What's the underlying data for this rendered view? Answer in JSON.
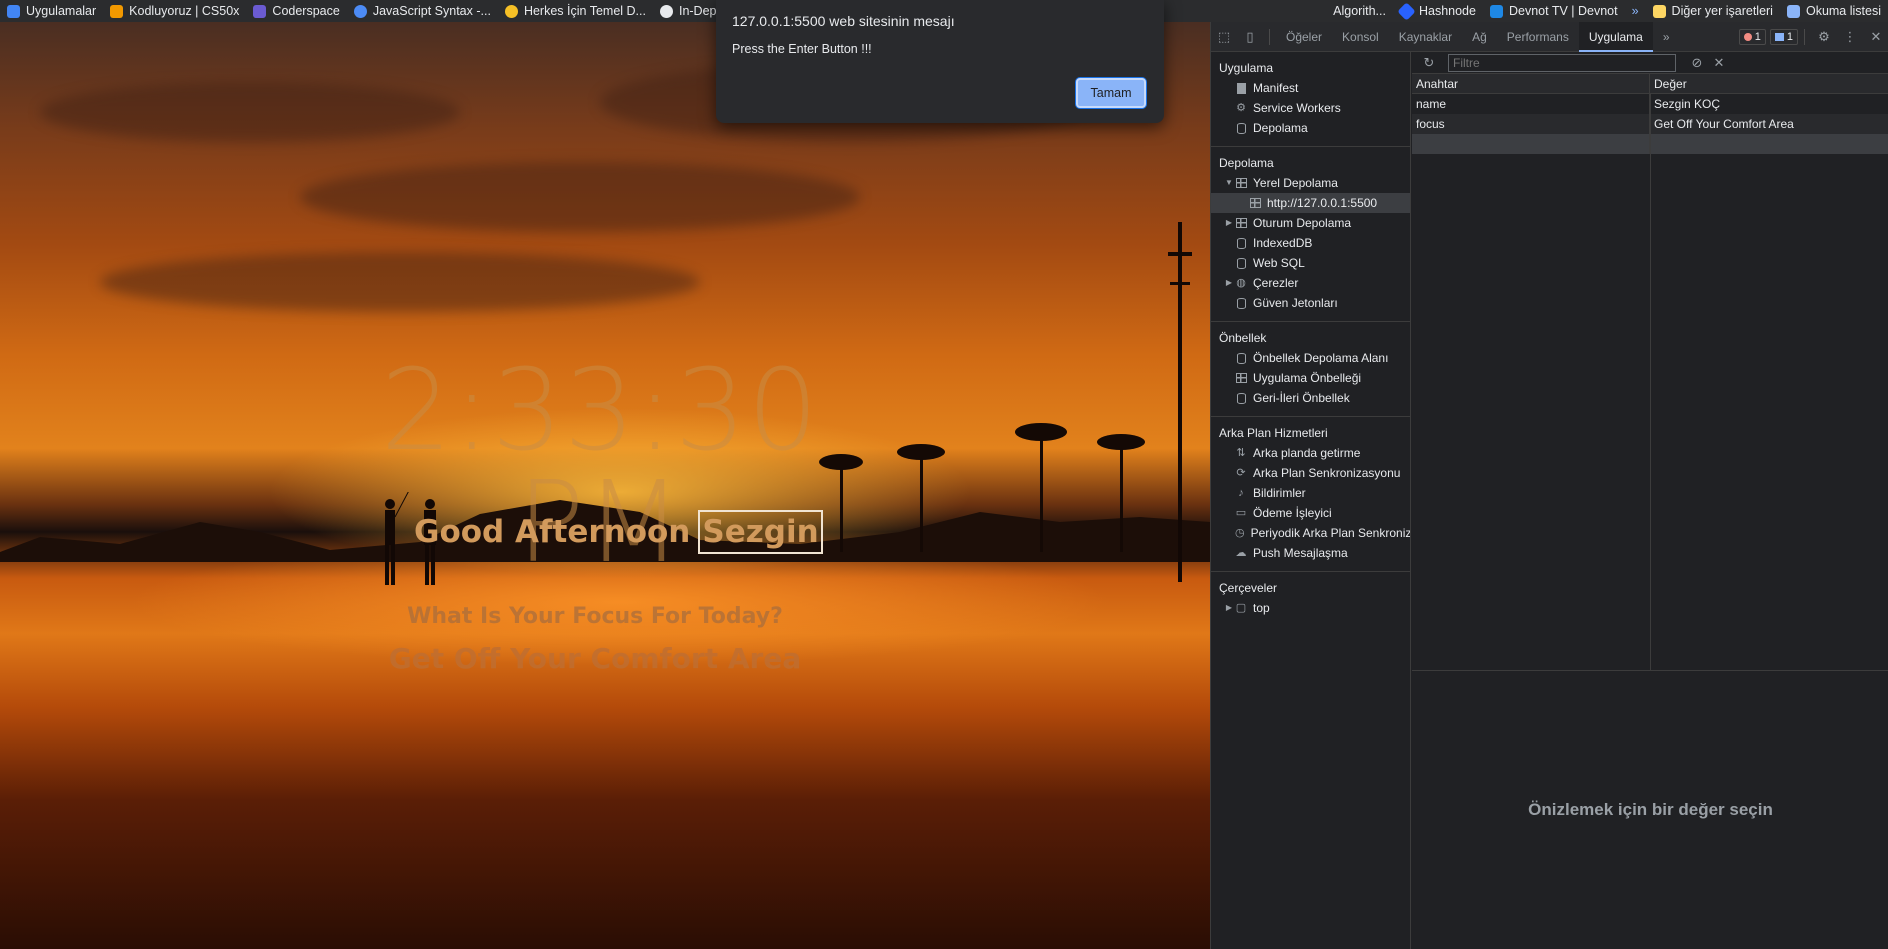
{
  "bookmarks": {
    "items": [
      {
        "label": "Uygulamalar",
        "color": "#4285f4"
      },
      {
        "label": "Kodluyoruz | CS50x",
        "color": "#f29900"
      },
      {
        "label": "Coderspace",
        "color": "#6b5bd2"
      },
      {
        "label": "JavaScript Syntax -...",
        "color": "#4c8bf5"
      },
      {
        "label": "Herkes İçin Temel D...",
        "color": "#f6c026"
      },
      {
        "label": "In-Depth",
        "color": "#e8eaed"
      }
    ],
    "right_items": [
      {
        "label": "Algorith...",
        "color": "#e8eaed"
      },
      {
        "label": "Hashnode",
        "color": "#2962ff"
      },
      {
        "label": "Devnot TV | Devnot",
        "color": "#1e88e5"
      },
      {
        "label": "»",
        "color": "#8ab4f8"
      },
      {
        "label": "Diğer yer işaretleri",
        "color": "#fdd663"
      },
      {
        "label": "Okuma listesi",
        "color": "#8ab4f8"
      }
    ]
  },
  "dialog": {
    "title": "127.0.0.1:5500 web sitesinin mesajı",
    "message": "Press the Enter Button !!!",
    "ok_label": "Tamam"
  },
  "page": {
    "time": "2:33:30 PM",
    "greeting": "Good Afternoon",
    "name": "Sezgin",
    "focus_question": "What Is Your Focus For Today?",
    "focus_answer": "Get Off Your Comfort Area"
  },
  "devtools": {
    "tabs": [
      "Öğeler",
      "Konsol",
      "Kaynaklar",
      "Ağ",
      "Performans",
      "Uygulama"
    ],
    "active_tab": "Uygulama",
    "more_tabs": "»",
    "error_count": "1",
    "message_count": "1",
    "sidebar": {
      "app_title": "Uygulama",
      "app_items": [
        {
          "label": "Manifest",
          "icon": "doc-icon"
        },
        {
          "label": "Service Workers",
          "icon": "gear-icon"
        },
        {
          "label": "Depolama",
          "icon": "database-icon"
        }
      ],
      "storage_title": "Depolama",
      "storage_items": [
        {
          "label": "Yerel Depolama",
          "icon": "grid-icon",
          "expanded": true
        },
        {
          "label": "http://127.0.0.1:5500",
          "icon": "grid-icon",
          "sub": true
        },
        {
          "label": "Oturum Depolama",
          "icon": "grid-icon",
          "collapsed": true
        },
        {
          "label": "IndexedDB",
          "icon": "database-icon"
        },
        {
          "label": "Web SQL",
          "icon": "database-icon"
        },
        {
          "label": "Çerezler",
          "icon": "cookie-icon",
          "collapsed": true
        },
        {
          "label": "Güven Jetonları",
          "icon": "database-icon"
        }
      ],
      "cache_title": "Önbellek",
      "cache_items": [
        {
          "label": "Önbellek Depolama Alanı",
          "icon": "database-icon"
        },
        {
          "label": "Uygulama Önbelleği",
          "icon": "grid-icon"
        },
        {
          "label": "Geri-İleri Önbellek",
          "icon": "database-icon"
        }
      ],
      "bg_title": "Arka Plan Hizmetleri",
      "bg_items": [
        {
          "label": "Arka planda getirme",
          "icon": "arrows-icon"
        },
        {
          "label": "Arka Plan Senkronizasyonu",
          "icon": "sync-icon"
        },
        {
          "label": "Bildirimler",
          "icon": "bell-icon"
        },
        {
          "label": "Ödeme İşleyici",
          "icon": "card-icon"
        },
        {
          "label": "Periyodik Arka Plan Senkroniz",
          "icon": "clock-icon"
        },
        {
          "label": "Push Mesajlaşma",
          "icon": "cloud-icon"
        }
      ],
      "frames_title": "Çerçeveler",
      "frames_items": [
        {
          "label": "top",
          "icon": "frame-icon"
        }
      ]
    },
    "main": {
      "filter_placeholder": "Filtre",
      "col_key": "Anahtar",
      "col_value": "Değer",
      "rows": [
        {
          "key": "name",
          "value": "Sezgin KOÇ"
        },
        {
          "key": "focus",
          "value": "Get Off Your Comfort Area"
        }
      ],
      "preview_text": "Önizlemek için bir değer seçin"
    }
  }
}
